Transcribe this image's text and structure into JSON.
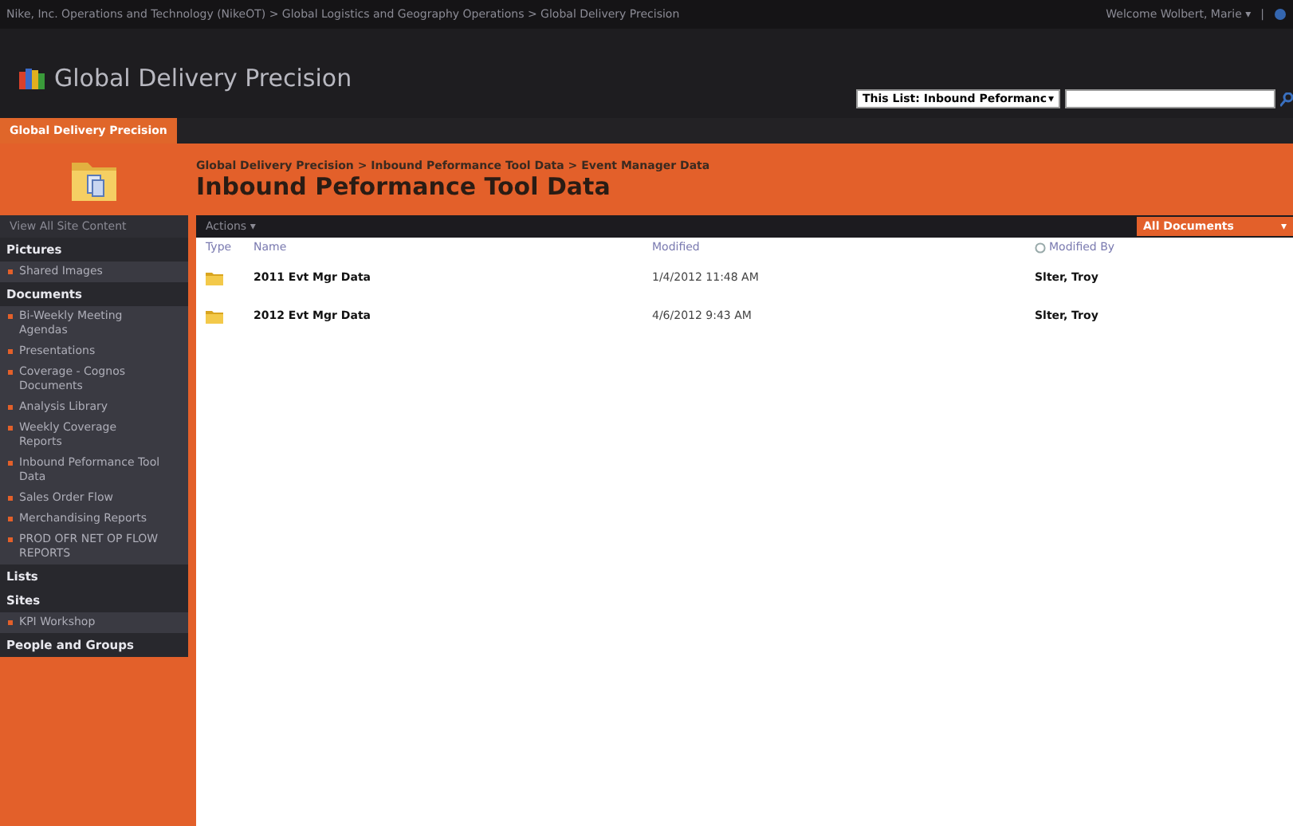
{
  "top_bar": {
    "breadcrumb": "Nike, Inc. Operations and Technology (NikeOT) > Global Logistics and Geography Operations > Global Delivery Precision",
    "welcome": "Welcome Wolbert, Marie",
    "welcome_caret": "▾",
    "separator": "|"
  },
  "site": {
    "title": "Global Delivery Precision"
  },
  "search": {
    "scope": "This List: Inbound Peformanc",
    "caret": "▾"
  },
  "tabs": [
    {
      "label": "Global Delivery Precision",
      "selected": true
    }
  ],
  "page": {
    "breadcrumb": "Global Delivery Precision > Inbound Peformance Tool Data > Event Manager Data",
    "title": "Inbound Peformance Tool Data"
  },
  "nav": {
    "view_all": "View All Site Content",
    "sections": [
      {
        "heading": "Pictures",
        "items": [
          "Shared Images"
        ]
      },
      {
        "heading": "Documents",
        "items": [
          "Bi-Weekly Meeting Agendas",
          "Presentations",
          "Coverage - Cognos Documents",
          "Analysis Library",
          "Weekly Coverage Reports",
          "Inbound Peformance Tool Data",
          "Sales Order Flow",
          "Merchandising Reports",
          "PROD OFR NET OP FLOW REPORTS"
        ]
      },
      {
        "heading": "Lists"
      },
      {
        "heading": "Sites",
        "items": [
          "KPI Workshop"
        ]
      },
      {
        "heading": "People and Groups"
      }
    ]
  },
  "toolbar": {
    "actions": "Actions",
    "actions_caret": "▾",
    "view": "All Documents",
    "view_caret": "▾"
  },
  "table": {
    "columns": [
      "Type",
      "Name",
      "Modified",
      "Modified By"
    ],
    "rows": [
      {
        "name": "2011 Evt Mgr Data",
        "modified": "1/4/2012 11:48 AM",
        "modified_by": "Slter, Troy"
      },
      {
        "name": "2012 Evt Mgr Data",
        "modified": "4/6/2012 9:43 AM",
        "modified_by": "Slter, Troy"
      }
    ]
  }
}
